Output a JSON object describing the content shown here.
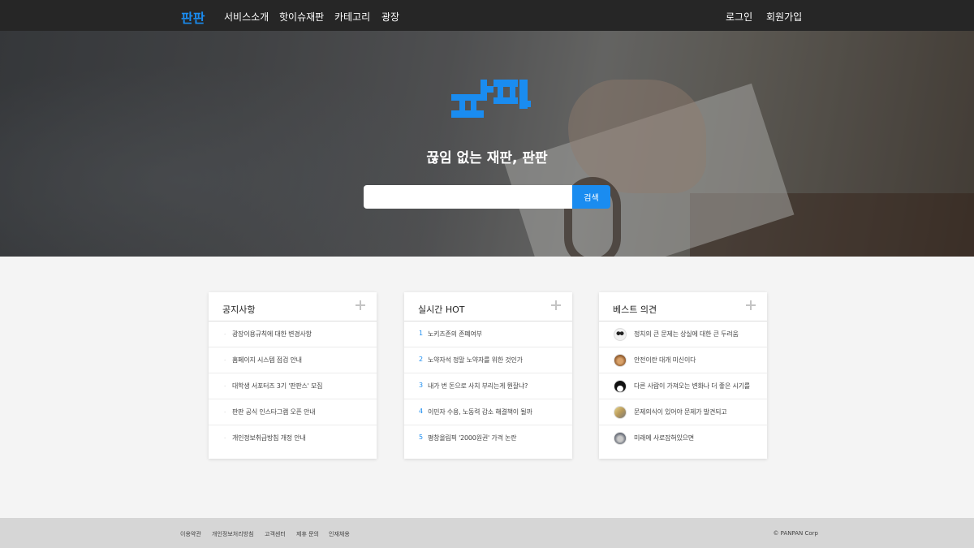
{
  "nav": {
    "logo": "판판",
    "links": [
      "서비스소개",
      "핫이슈재판",
      "카테고리",
      "광장"
    ],
    "auth": [
      "로그인",
      "회원가입"
    ],
    "accent": "#1a8cf0"
  },
  "hero": {
    "tagline": "끊임 없는 재판, 판판",
    "search_placeholder": "",
    "search_button": "검색",
    "logo_icon": "panpan-logo-icon"
  },
  "cards": [
    {
      "title": "공지사항",
      "items": [
        "광장이용규칙에 대한 변경사항",
        "홈페이지 시스템 점검 안내",
        "대학생 서포터즈 3기 '판판스' 모집",
        "판판 공식 인스타그램 오픈 안내",
        "개인정보취급방침 개정 안내"
      ]
    },
    {
      "title": "실시간 HOT",
      "items": [
        {
          "num": "1",
          "text": "노키즈존의 존폐여부"
        },
        {
          "num": "2",
          "text": "노약자석 정말 노약자를 위한 것인가"
        },
        {
          "num": "3",
          "text": "내가 번 돈으로 사치 부리는게 뭔잘냐?"
        },
        {
          "num": "4",
          "text": "이민자 수용, 노동력 감소 해결책이 될까"
        },
        {
          "num": "5",
          "text": "평창올림픽 '2000원권' 가격 논란"
        }
      ]
    },
    {
      "title": "베스트 의견",
      "items": [
        {
          "avatar": "panda-avatar-icon",
          "text": "정치의 큰 문제는 상실에 대한 큰 두려움"
        },
        {
          "avatar": "dog-avatar-icon",
          "text": "안전이란 대개 미신이다"
        },
        {
          "avatar": "penguin-avatar-icon",
          "text": "다른 사람이 가져오는 변화나 더 좋은 시기를"
        },
        {
          "avatar": "bird-avatar-icon",
          "text": "문제의식이 있어야 문제가 발견되고"
        },
        {
          "avatar": "cat-avatar-icon",
          "text": "미래에 사로잡혀있으면"
        }
      ]
    }
  ],
  "footer": {
    "links": [
      "이용약관",
      "개인정보처리방침",
      "고객센터",
      "제휴 문의",
      "인재채용"
    ],
    "copyright": "© PANPAN Corp"
  }
}
